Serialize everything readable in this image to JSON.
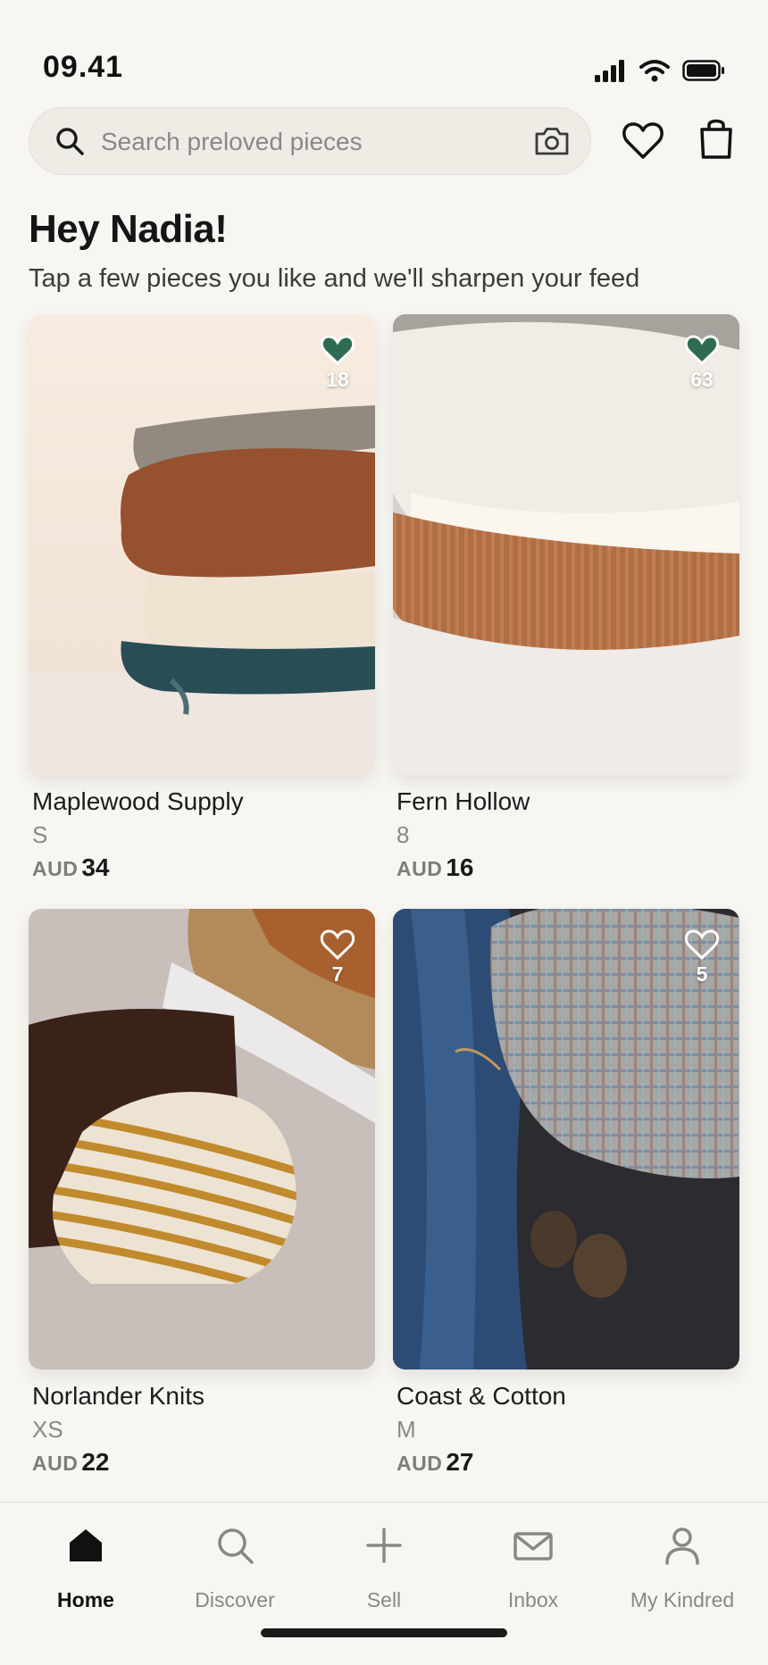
{
  "status_bar": {
    "time": "09.41"
  },
  "search": {
    "placeholder": "Search preloved pieces"
  },
  "greeting": {
    "title": "Hey Nadia!",
    "subtitle": "Tap a few pieces you like and we'll sharpen your feed"
  },
  "listings": [
    {
      "seller": "Maplewood Supply",
      "size": "S",
      "currency": "AUD",
      "price": "34",
      "likes": "18",
      "liked": true,
      "image": "stacked-knit-sweaters-rust-cream-teal"
    },
    {
      "seller": "Fern Hollow",
      "size": "8",
      "currency": "AUD",
      "price": "16",
      "likes": "63",
      "liked": true,
      "image": "folded-cream-and-rust-knits-on-bed"
    },
    {
      "seller": "Norlander Knits",
      "size": "XS",
      "currency": "AUD",
      "price": "22",
      "likes": "7",
      "liked": false,
      "image": "striped-beanie-and-brown-knit"
    },
    {
      "seller": "Coast & Cotton",
      "size": "M",
      "currency": "AUD",
      "price": "27",
      "likes": "5",
      "liked": false,
      "image": "denim-jacket-plaid-cap-pinecones"
    }
  ],
  "tabs": [
    {
      "label": "Home",
      "icon": "house-icon",
      "active": true
    },
    {
      "label": "Discover",
      "icon": "search-icon",
      "active": false
    },
    {
      "label": "Sell",
      "icon": "plus-icon",
      "active": false
    },
    {
      "label": "Inbox",
      "icon": "envelope-icon",
      "active": false
    },
    {
      "label": "My Kindred",
      "icon": "person-icon",
      "active": false
    }
  ],
  "colors": {
    "accent": "#2f6b52",
    "background": "#f8f6f2",
    "search_bg": "#efece6",
    "muted_text": "#8a8884"
  }
}
